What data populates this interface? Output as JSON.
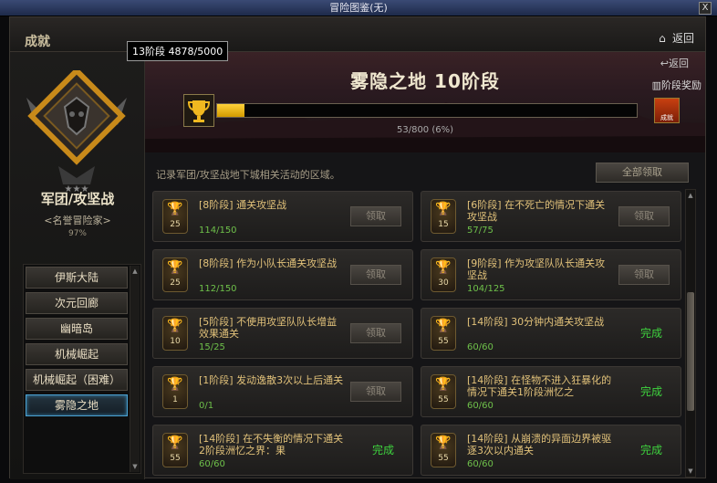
{
  "window": {
    "title": "冒险图鉴(无)",
    "close_label": "X"
  },
  "header": {
    "title": "成就",
    "back_label": "返回"
  },
  "tooltip": {
    "text": "13阶段 4878/5000"
  },
  "category": {
    "title": "军团/攻坚战",
    "subtitle": "<名誉冒险家>",
    "percent": "97%"
  },
  "categories": [
    {
      "label": "伊斯大陆"
    },
    {
      "label": "次元回廊"
    },
    {
      "label": "幽暗岛"
    },
    {
      "label": "机械崛起"
    },
    {
      "label": "机械崛起（困难）"
    },
    {
      "label": "雾隐之地"
    }
  ],
  "stage": {
    "title": "雾隐之地  10阶段",
    "back_label": "返回",
    "reward_label": "阶段奖励",
    "progress_text": "53/800 (6%)",
    "progress_fraction": 0.066,
    "chest_label": "成就"
  },
  "description": "记录军团/攻坚战地下城相关活动的区域。",
  "claim_all_label": "全部领取",
  "achievements": [
    {
      "tier": "25",
      "title": "[8阶段] 通关攻坚战",
      "progress": "114/150",
      "status": "领取",
      "done": false
    },
    {
      "tier": "15",
      "title": "[6阶段] 在不死亡的情况下通关攻坚战",
      "progress": "57/75",
      "status": "领取",
      "done": false
    },
    {
      "tier": "25",
      "title": "[8阶段] 作为小队长通关攻坚战",
      "progress": "112/150",
      "status": "领取",
      "done": false
    },
    {
      "tier": "30",
      "title": "[9阶段] 作为攻坚队队长通关攻坚战",
      "progress": "104/125",
      "status": "领取",
      "done": false
    },
    {
      "tier": "10",
      "title": "[5阶段] 不使用攻坚队队长增益效果通关",
      "progress": "15/25",
      "status": "领取",
      "done": false
    },
    {
      "tier": "55",
      "title": "[14阶段] 30分钟内通关攻坚战",
      "progress": "60/60",
      "status": "完成",
      "done": true
    },
    {
      "tier": "1",
      "title": "[1阶段] 发动逸散3次以上后通关",
      "progress": "0/1",
      "status": "领取",
      "done": false
    },
    {
      "tier": "55",
      "title": "[14阶段] 在怪物不进入狂暴化的情况下通关1阶段洲忆之",
      "progress": "60/60",
      "status": "完成",
      "done": true
    },
    {
      "tier": "55",
      "title": "[14阶段] 在不失衡的情况下通关2阶段洲忆之界：果",
      "progress": "60/60",
      "status": "完成",
      "done": true
    },
    {
      "tier": "55",
      "title": "[14阶段] 从崩溃的异面边界被驱逐3次以内通关",
      "progress": "60/60",
      "status": "完成",
      "done": true
    }
  ],
  "colors": {
    "accent_gold": "#f0b820",
    "done_green": "#3ed23e",
    "progress_green": "#6ec04a",
    "active_blue": "#4aa0d0"
  }
}
